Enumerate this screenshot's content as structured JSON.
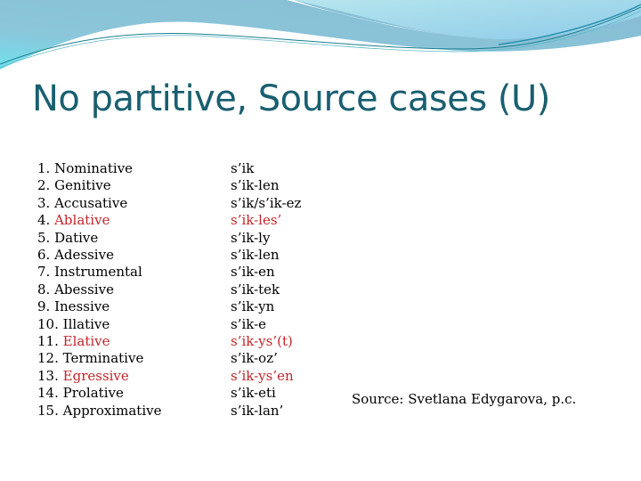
{
  "slide": {
    "title": "No partitive, Source cases (U)",
    "cases": [
      {
        "num": "1.",
        "name": "Nominative",
        "form": "s’ik",
        "highlight": false
      },
      {
        "num": "2.",
        "name": "Genitive",
        "form": "s’ik-len",
        "highlight": false
      },
      {
        "num": "3.",
        "name": "Accusative",
        "form": "s’ik/s’ik-ez",
        "highlight": false
      },
      {
        "num": "4.",
        "name": "Ablative",
        "form": "s’ik-les’",
        "highlight": true
      },
      {
        "num": "5.",
        "name": "Dative",
        "form": "s’ik-ly",
        "highlight": false
      },
      {
        "num": "6.",
        "name": "Adessive",
        "form": "s’ik-len",
        "highlight": false
      },
      {
        "num": "7.",
        "name": "Instrumental",
        "form": "s’ik-en",
        "highlight": false
      },
      {
        "num": "8.",
        "name": "Abessive",
        "form": "s’ik-tek",
        "highlight": false
      },
      {
        "num": "9.",
        "name": "Inessive",
        "form": "s’ik-yn",
        "highlight": false
      },
      {
        "num": "10.",
        "name": "Illative",
        "form": "s’ik-e",
        "highlight": false
      },
      {
        "num": "11.",
        "name": "Elative",
        "form": "s’ik-ys’(t)",
        "highlight": true
      },
      {
        "num": "12.",
        "name": "Terminative",
        "form": "s’ik-oz’",
        "highlight": false
      },
      {
        "num": "13.",
        "name": "Egressive",
        "form": "s’ik-ys’en",
        "highlight": true
      },
      {
        "num": "14.",
        "name": "Prolative",
        "form": "s’ik-eti",
        "highlight": false
      },
      {
        "num": "15.",
        "name": "Approximative",
        "form": "s’ik-lan’",
        "highlight": false
      }
    ],
    "source": "Source: Svetlana Edygarova, p.c.",
    "colors": {
      "title": "#1a5f70",
      "highlight": "#c0262b",
      "text": "#000000"
    }
  }
}
